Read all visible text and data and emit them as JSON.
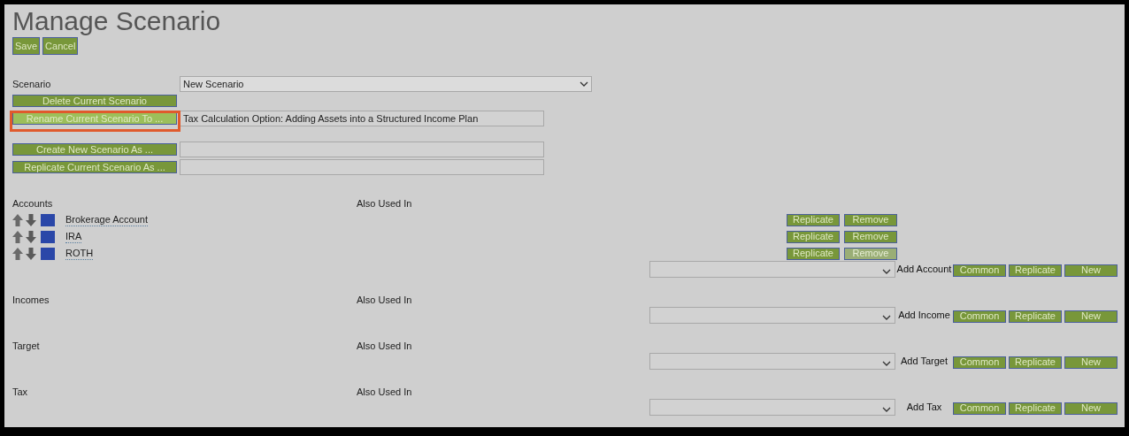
{
  "title": "Manage Scenario",
  "actions": [
    {
      "label": "Save"
    },
    {
      "label": "Cancel"
    }
  ],
  "scenario": {
    "label": "Scenario",
    "value": "New Scenario"
  },
  "scenario_actions": [
    {
      "kind": "plain",
      "label": "Delete Current Scenario",
      "highlighted": false
    },
    {
      "kind": "with_field",
      "label": "Rename Current Scenario To ...",
      "value": "Tax Calculation Option: Adding Assets into a Structured Income Plan",
      "highlighted": true
    }
  ],
  "new_scenario_actions": [
    {
      "kind": "with_field",
      "label": "Create New Scenario As ...",
      "highlighted": false
    },
    {
      "kind": "with_field",
      "label": "Replicate Current Scenario As ...",
      "highlighted": false
    }
  ],
  "sections": [
    {
      "title": "Accounts",
      "also_used_in": "Also Used In",
      "items": [
        {
          "name": "Brokerage Account",
          "buttons": [
            {
              "label": "Replicate",
              "disabled": false
            },
            {
              "label": "Remove",
              "disabled": false
            }
          ]
        },
        {
          "name": "IRA",
          "buttons": [
            {
              "label": "Replicate",
              "disabled": false
            },
            {
              "label": "Remove",
              "disabled": false
            }
          ]
        },
        {
          "name": "ROTH",
          "buttons": [
            {
              "label": "Replicate",
              "disabled": false
            },
            {
              "label": "Remove",
              "disabled": true
            }
          ]
        }
      ],
      "add_label": "Add Account",
      "add_buttons": [
        "Common",
        "Replicate",
        "New"
      ]
    },
    {
      "title": "Incomes",
      "also_used_in": "Also Used In",
      "add_label": "Add Income",
      "add_buttons": [
        "Common",
        "Replicate",
        "New"
      ]
    },
    {
      "title": "Target",
      "also_used_in": "Also Used In",
      "add_label": "Add Target",
      "add_buttons": [
        "Common",
        "Replicate",
        "New"
      ]
    },
    {
      "title": "Tax",
      "also_used_in": "Also Used In",
      "add_label": "Add Tax",
      "add_buttons": [
        "Common",
        "Replicate",
        "New"
      ]
    }
  ]
}
